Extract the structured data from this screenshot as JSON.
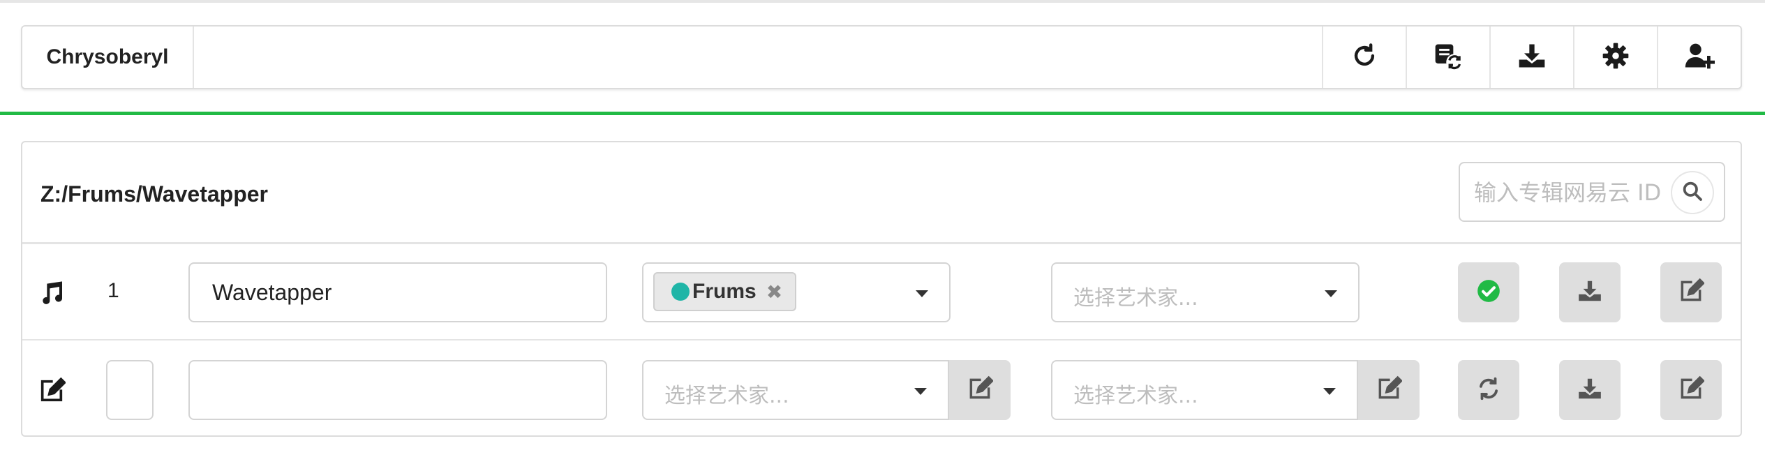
{
  "header": {
    "brand": "Chrysoberyl",
    "buttons": [
      {
        "icon": "refresh-icon"
      },
      {
        "icon": "playlist-sync-icon"
      },
      {
        "icon": "download-icon"
      },
      {
        "icon": "gear-icon"
      },
      {
        "icon": "add-user-icon"
      }
    ]
  },
  "accent_color": "#21ba45",
  "album": {
    "path": "Z:/Frums/Wavetapper",
    "search_placeholder": "输入专辑网易云 ID..."
  },
  "tracks": [
    {
      "row_icon": "music-note-icon",
      "number": "1",
      "title": "Wavetapper",
      "artists": [
        {
          "name": "Frums",
          "dot_color": "#1fb5a7"
        }
      ],
      "album_artist_placeholder": "选择艺术家...",
      "status_icon": "check-circle-icon",
      "status_color": "#21ba45"
    }
  ],
  "new_row": {
    "row_icon": "edit-icon",
    "number": "",
    "title": "",
    "artist_placeholder": "选择艺术家...",
    "album_artist_placeholder": "选择艺术家..."
  }
}
